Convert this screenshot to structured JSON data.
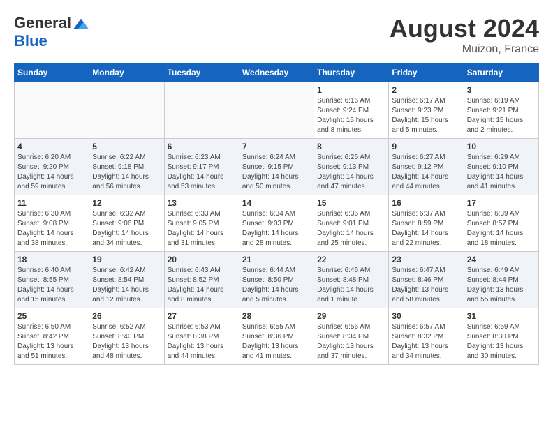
{
  "header": {
    "logo_general": "General",
    "logo_blue": "Blue",
    "month_year": "August 2024",
    "location": "Muizon, France"
  },
  "calendar": {
    "days_of_week": [
      "Sunday",
      "Monday",
      "Tuesday",
      "Wednesday",
      "Thursday",
      "Friday",
      "Saturday"
    ],
    "weeks": [
      [
        {
          "day": "",
          "info": ""
        },
        {
          "day": "",
          "info": ""
        },
        {
          "day": "",
          "info": ""
        },
        {
          "day": "",
          "info": ""
        },
        {
          "day": "1",
          "info": "Sunrise: 6:16 AM\nSunset: 9:24 PM\nDaylight: 15 hours\nand 8 minutes."
        },
        {
          "day": "2",
          "info": "Sunrise: 6:17 AM\nSunset: 9:23 PM\nDaylight: 15 hours\nand 5 minutes."
        },
        {
          "day": "3",
          "info": "Sunrise: 6:19 AM\nSunset: 9:21 PM\nDaylight: 15 hours\nand 2 minutes."
        }
      ],
      [
        {
          "day": "4",
          "info": "Sunrise: 6:20 AM\nSunset: 9:20 PM\nDaylight: 14 hours\nand 59 minutes."
        },
        {
          "day": "5",
          "info": "Sunrise: 6:22 AM\nSunset: 9:18 PM\nDaylight: 14 hours\nand 56 minutes."
        },
        {
          "day": "6",
          "info": "Sunrise: 6:23 AM\nSunset: 9:17 PM\nDaylight: 14 hours\nand 53 minutes."
        },
        {
          "day": "7",
          "info": "Sunrise: 6:24 AM\nSunset: 9:15 PM\nDaylight: 14 hours\nand 50 minutes."
        },
        {
          "day": "8",
          "info": "Sunrise: 6:26 AM\nSunset: 9:13 PM\nDaylight: 14 hours\nand 47 minutes."
        },
        {
          "day": "9",
          "info": "Sunrise: 6:27 AM\nSunset: 9:12 PM\nDaylight: 14 hours\nand 44 minutes."
        },
        {
          "day": "10",
          "info": "Sunrise: 6:29 AM\nSunset: 9:10 PM\nDaylight: 14 hours\nand 41 minutes."
        }
      ],
      [
        {
          "day": "11",
          "info": "Sunrise: 6:30 AM\nSunset: 9:08 PM\nDaylight: 14 hours\nand 38 minutes."
        },
        {
          "day": "12",
          "info": "Sunrise: 6:32 AM\nSunset: 9:06 PM\nDaylight: 14 hours\nand 34 minutes."
        },
        {
          "day": "13",
          "info": "Sunrise: 6:33 AM\nSunset: 9:05 PM\nDaylight: 14 hours\nand 31 minutes."
        },
        {
          "day": "14",
          "info": "Sunrise: 6:34 AM\nSunset: 9:03 PM\nDaylight: 14 hours\nand 28 minutes."
        },
        {
          "day": "15",
          "info": "Sunrise: 6:36 AM\nSunset: 9:01 PM\nDaylight: 14 hours\nand 25 minutes."
        },
        {
          "day": "16",
          "info": "Sunrise: 6:37 AM\nSunset: 8:59 PM\nDaylight: 14 hours\nand 22 minutes."
        },
        {
          "day": "17",
          "info": "Sunrise: 6:39 AM\nSunset: 8:57 PM\nDaylight: 14 hours\nand 18 minutes."
        }
      ],
      [
        {
          "day": "18",
          "info": "Sunrise: 6:40 AM\nSunset: 8:55 PM\nDaylight: 14 hours\nand 15 minutes."
        },
        {
          "day": "19",
          "info": "Sunrise: 6:42 AM\nSunset: 8:54 PM\nDaylight: 14 hours\nand 12 minutes."
        },
        {
          "day": "20",
          "info": "Sunrise: 6:43 AM\nSunset: 8:52 PM\nDaylight: 14 hours\nand 8 minutes."
        },
        {
          "day": "21",
          "info": "Sunrise: 6:44 AM\nSunset: 8:50 PM\nDaylight: 14 hours\nand 5 minutes."
        },
        {
          "day": "22",
          "info": "Sunrise: 6:46 AM\nSunset: 8:48 PM\nDaylight: 14 hours\nand 1 minute."
        },
        {
          "day": "23",
          "info": "Sunrise: 6:47 AM\nSunset: 8:46 PM\nDaylight: 13 hours\nand 58 minutes."
        },
        {
          "day": "24",
          "info": "Sunrise: 6:49 AM\nSunset: 8:44 PM\nDaylight: 13 hours\nand 55 minutes."
        }
      ],
      [
        {
          "day": "25",
          "info": "Sunrise: 6:50 AM\nSunset: 8:42 PM\nDaylight: 13 hours\nand 51 minutes."
        },
        {
          "day": "26",
          "info": "Sunrise: 6:52 AM\nSunset: 8:40 PM\nDaylight: 13 hours\nand 48 minutes."
        },
        {
          "day": "27",
          "info": "Sunrise: 6:53 AM\nSunset: 8:38 PM\nDaylight: 13 hours\nand 44 minutes."
        },
        {
          "day": "28",
          "info": "Sunrise: 6:55 AM\nSunset: 8:36 PM\nDaylight: 13 hours\nand 41 minutes."
        },
        {
          "day": "29",
          "info": "Sunrise: 6:56 AM\nSunset: 8:34 PM\nDaylight: 13 hours\nand 37 minutes."
        },
        {
          "day": "30",
          "info": "Sunrise: 6:57 AM\nSunset: 8:32 PM\nDaylight: 13 hours\nand 34 minutes."
        },
        {
          "day": "31",
          "info": "Sunrise: 6:59 AM\nSunset: 8:30 PM\nDaylight: 13 hours\nand 30 minutes."
        }
      ]
    ]
  }
}
